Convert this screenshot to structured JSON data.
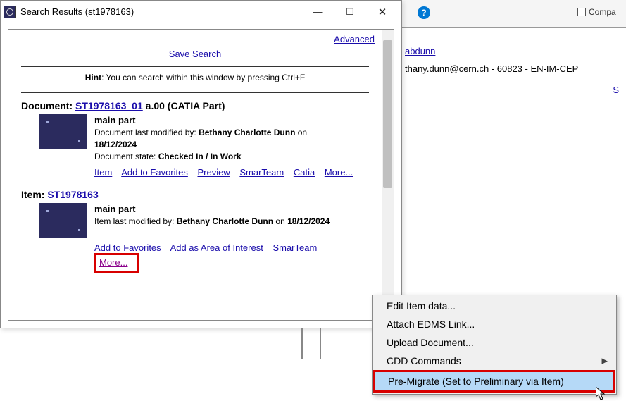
{
  "bg": {
    "help_icon": "?",
    "compact_label": "Compa",
    "user_link": "abdunn",
    "user_line_prefix": "thany.dunn@cern.ch - 60823 - EN-IM-CEP",
    "s_link": "S"
  },
  "window": {
    "title": "Search Results (st1978163)",
    "minimize": "—",
    "maximize": "☐",
    "close": "✕",
    "advanced": "Advanced",
    "save_search": "Save Search",
    "hint_label": "Hint",
    "hint_text": ": You can search within this window by pressing Ctrl+F"
  },
  "document": {
    "prefix": "Document: ",
    "id_link": "ST1978163_01",
    "suffix": " a.00 (CATIA Part)",
    "name": "main part",
    "mod_by_label": "Document last modified by: ",
    "mod_by": "Bethany Charlotte Dunn",
    "mod_on_label": " on ",
    "mod_date": "18/12/2024",
    "state_label": "Document state: ",
    "state": "Checked In / In Work",
    "links": {
      "item": "Item",
      "fav": "Add to Favorites",
      "preview": "Preview",
      "smarteam": "SmarTeam",
      "catia": "Catia",
      "more": "More..."
    }
  },
  "item": {
    "prefix": "Item: ",
    "id_link": "ST1978163",
    "name": "main part",
    "mod_by_label": "Item last modified by: ",
    "mod_by": "Bethany Charlotte Dunn",
    "mod_on_label": " on ",
    "mod_date": "18/12/2024",
    "links": {
      "fav": "Add to Favorites",
      "aoi": "Add as Area of Interest",
      "smarteam": "SmarTeam",
      "more": "More..."
    }
  },
  "context_menu": {
    "edit": "Edit Item data...",
    "attach": "Attach EDMS Link...",
    "upload": "Upload Document...",
    "cdd": "CDD Commands",
    "premigrate": "Pre-Migrate (Set to Preliminary via Item)",
    "submenu_arrow": "▶"
  }
}
